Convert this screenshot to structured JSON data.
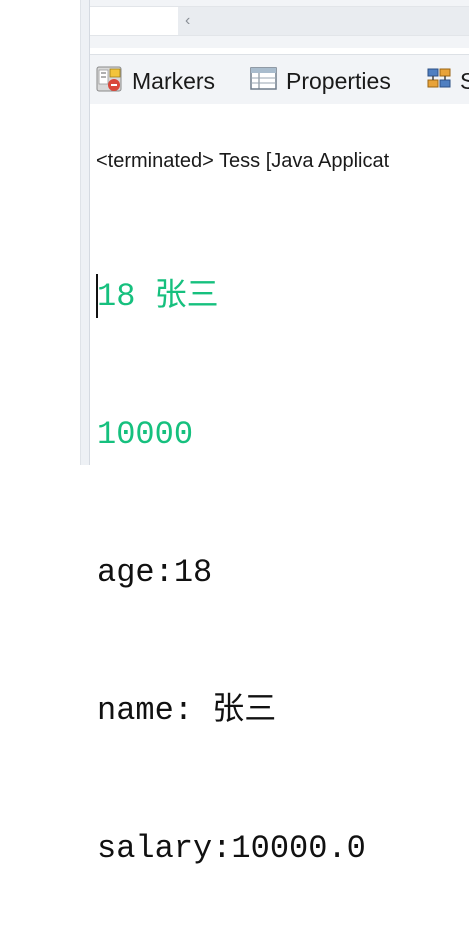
{
  "scrollbar": {
    "left_arrow": "‹"
  },
  "view_tabs": [
    {
      "label": "Markers",
      "icon": "markers-icon"
    },
    {
      "label": "Properties",
      "icon": "properties-icon"
    },
    {
      "label": "S",
      "icon": "servers-icon"
    }
  ],
  "console": {
    "header": "<terminated> Tess [Java Applicat",
    "lines": [
      {
        "text": "18 张三",
        "color": "#16c07e"
      },
      {
        "text": "10000",
        "color": "#16c07e"
      },
      {
        "text": "age:18",
        "color": "#111111"
      },
      {
        "text": "name: 张三",
        "color": "#111111"
      },
      {
        "text": "salary:10000.0",
        "color": "#111111"
      }
    ]
  }
}
